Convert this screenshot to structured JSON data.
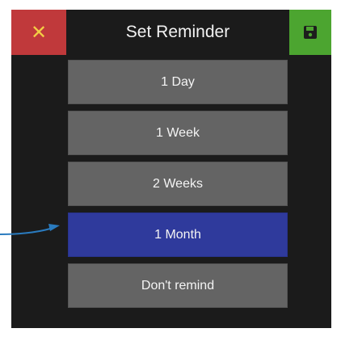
{
  "dialog": {
    "title": "Set Reminder",
    "close_icon": "close-icon",
    "save_icon": "floppy-disk-save-icon"
  },
  "options": [
    {
      "label": "1 Day",
      "selected": false
    },
    {
      "label": "1 Week",
      "selected": false
    },
    {
      "label": "2 Weeks",
      "selected": false
    },
    {
      "label": "1 Month",
      "selected": true
    },
    {
      "label": "Don't remind",
      "selected": false
    }
  ],
  "annotation": {
    "arrow_target": "1 Month"
  },
  "colors": {
    "panel_background": "#1b1b1b",
    "close_button": "#c0393b",
    "close_icon": "#f3ce45",
    "save_button": "#4ca530",
    "option_button": "#646464",
    "selected_option": "#2f3a9c",
    "annotation_arrow": "#2a7bbf"
  }
}
